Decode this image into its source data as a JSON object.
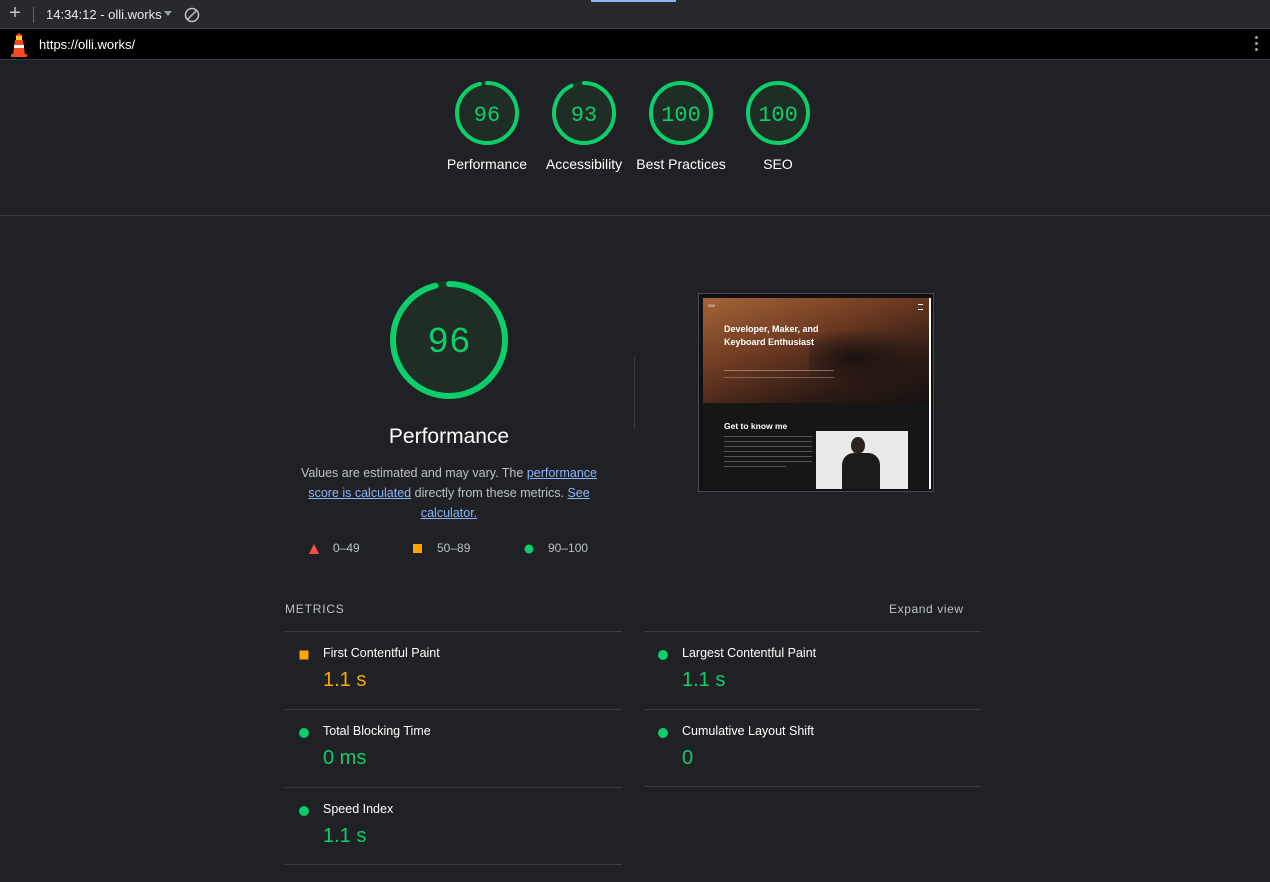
{
  "toolbar": {
    "add_label": "+",
    "report_title": "14:34:12 - olli.works"
  },
  "urlbar": {
    "url": "https://olli.works/"
  },
  "categories": [
    {
      "score": "96",
      "label": "Performance",
      "color": "#0cce6b"
    },
    {
      "score": "93",
      "label": "Accessibility",
      "color": "#0cce6b"
    },
    {
      "score": "100",
      "label": "Best Practices",
      "color": "#0cce6b"
    },
    {
      "score": "100",
      "label": "SEO",
      "color": "#0cce6b"
    }
  ],
  "performance": {
    "score": "96",
    "title": "Performance",
    "desc_prefix": "Values are estimated and may vary. The ",
    "link_score": "performance score is calculated",
    "desc_middle": " directly from these metrics. ",
    "link_calc": "See calculator."
  },
  "legend": [
    {
      "range": "0–49",
      "shape": "triangle",
      "color": "#ff4e42"
    },
    {
      "range": "50–89",
      "shape": "square",
      "color": "#ffa400"
    },
    {
      "range": "90–100",
      "shape": "circle",
      "color": "#0cce6b"
    }
  ],
  "thumbnail": {
    "brand": "OW",
    "headline": "Developer, Maker, and Keyboard Enthusiast",
    "section_title": "Get to know me"
  },
  "metrics": {
    "header": "METRICS",
    "expand_label": "Expand view",
    "items": [
      {
        "name": "First Contentful Paint",
        "value": "1.1 s",
        "rating": "average",
        "color": "#ffa400"
      },
      {
        "name": "Largest Contentful Paint",
        "value": "1.1 s",
        "rating": "pass",
        "color": "#0cce6b"
      },
      {
        "name": "Total Blocking Time",
        "value": "0 ms",
        "rating": "pass",
        "color": "#0cce6b"
      },
      {
        "name": "Cumulative Layout Shift",
        "value": "0",
        "rating": "pass",
        "color": "#0cce6b"
      },
      {
        "name": "Speed Index",
        "value": "1.1 s",
        "rating": "pass",
        "color": "#0cce6b"
      }
    ]
  }
}
